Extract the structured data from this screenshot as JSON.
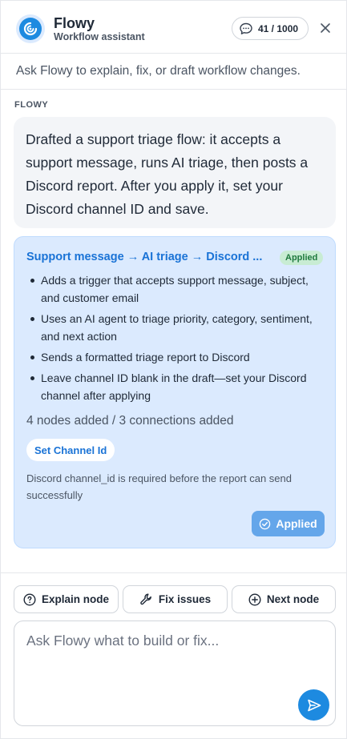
{
  "header": {
    "title": "Flowy",
    "subtitle": "Workflow assistant",
    "counter": "41 / 1000",
    "logo_icon": "swirl-icon",
    "close_icon": "close-icon"
  },
  "hint": "Ask Flowy to explain, fix, or draft workflow changes.",
  "message": {
    "sender": "FLOWY",
    "text": "Drafted a support triage flow: it accepts a support message, runs AI triage, then posts a Discord report. After you apply it, set your Discord channel ID and save."
  },
  "card": {
    "title": "Support message → AI triage → Discord ...",
    "badge": "Applied",
    "bullets": [
      "Adds a trigger that accepts support message, subject, and customer email",
      "Uses an AI agent to triage priority, category, sentiment, and next action",
      "Sends a formatted triage report to Discord",
      "Leave channel ID blank in the draft—set your Discord channel after applying"
    ],
    "stats": "4 nodes added / 3 connections added",
    "chip_label": "Set Channel Id",
    "note": "Discord channel_id is required before the report can send successfully",
    "applied_button": "Applied"
  },
  "actions": [
    {
      "label": "Explain node",
      "icon": "question-circle-icon"
    },
    {
      "label": "Fix issues",
      "icon": "wrench-icon"
    },
    {
      "label": "Next node",
      "icon": "plus-circle-icon"
    }
  ],
  "input": {
    "placeholder": "Ask Flowy what to build or fix...",
    "value": ""
  },
  "colors": {
    "accent": "#1d8ae0",
    "card_bg": "#dbeafe",
    "badge_bg": "#c8ecd3",
    "badge_text": "#1f7a3e"
  }
}
